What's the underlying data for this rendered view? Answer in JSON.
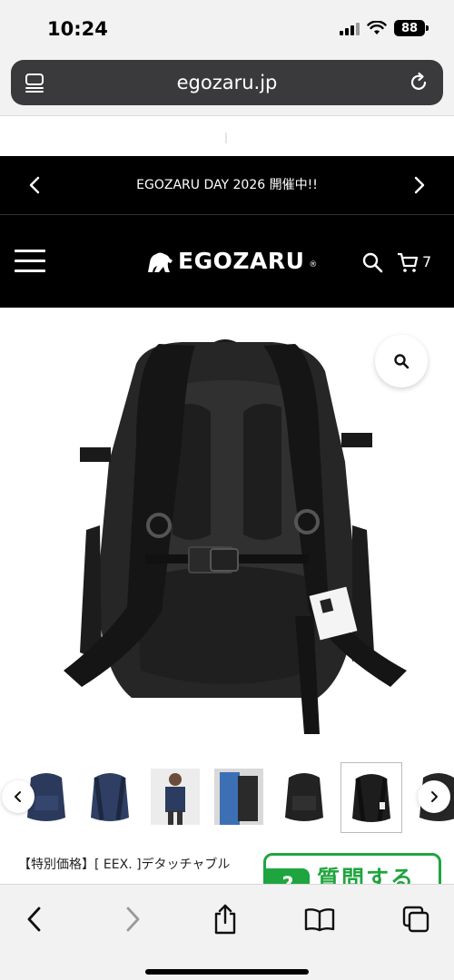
{
  "status_bar": {
    "time": "10:24",
    "battery": "88"
  },
  "browser": {
    "url": "egozaru.jp"
  },
  "announcement": {
    "text": "EGOZARU DAY 2026 開催中!!"
  },
  "header": {
    "logo_text": "EGOZARU",
    "logo_reg": "®",
    "cart_count": "7"
  },
  "product": {
    "title": "【特別価格】[ EEX. ]デタッチャブル",
    "thumbnails": [
      {
        "name": "navy-front",
        "color": "#2b3a5c"
      },
      {
        "name": "navy-back",
        "color": "#2f3f63"
      },
      {
        "name": "model-navy",
        "color": "#2c3b60"
      },
      {
        "name": "model-blue",
        "color": "#3d6fb5"
      },
      {
        "name": "black-front",
        "color": "#222222"
      },
      {
        "name": "black-back",
        "color": "#1d1d1d"
      },
      {
        "name": "black-side",
        "color": "#262626"
      }
    ],
    "selected_thumbnail": 6
  },
  "question_button": {
    "icon": "?",
    "label": "質問する"
  },
  "colors": {
    "accent_green": "#1fa53f",
    "header_bg": "#000000"
  },
  "icons": [
    "tabs-icon",
    "reload-icon",
    "chevron-left-icon",
    "chevron-right-icon",
    "menu-icon",
    "search-icon",
    "cart-icon",
    "zoom-icon",
    "share-icon",
    "bookmarks-icon",
    "tabs-overview-icon"
  ]
}
